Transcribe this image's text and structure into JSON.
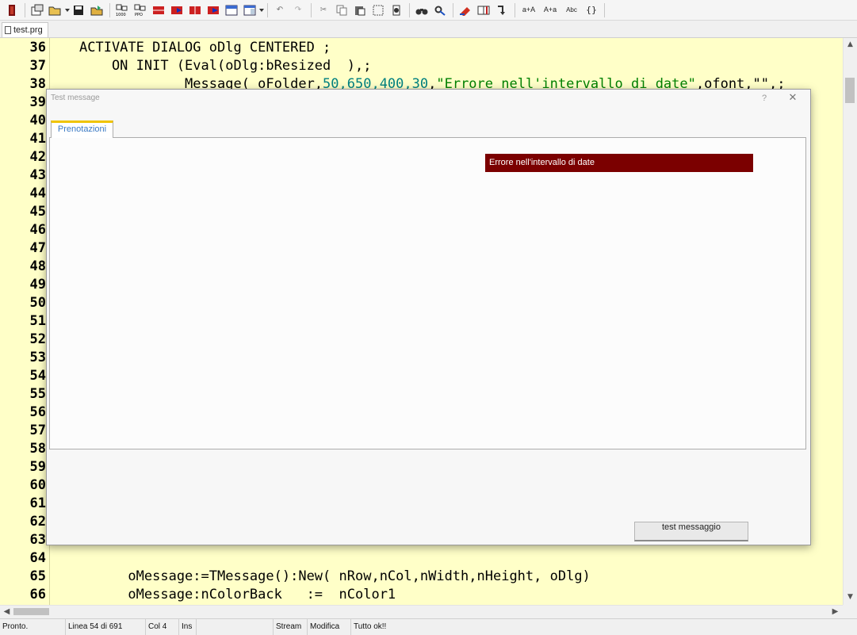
{
  "toolbar": {
    "icons": [
      "exit-icon",
      "new-project-icon",
      "open-folder-icon",
      "save-icon",
      "open-file-icon",
      "build-icon",
      "build-ppo-icon",
      "macro-icon-1",
      "macro-icon-2",
      "macro-icon-3",
      "macro-icon-4",
      "window-icon-1",
      "window-icon-2",
      "undo-icon",
      "redo-icon",
      "cut-icon",
      "copy-icon",
      "paste-icon",
      "select-all-icon",
      "replace-icon",
      "find-icon",
      "find-next-icon",
      "bookmark-icon",
      "book-icon",
      "goto-icon",
      "lowercase-icon",
      "uppercase-icon",
      "spell-check-icon",
      "braces-icon"
    ],
    "text_buttons": {
      "lowercase": "a+A",
      "uppercase": "A+a",
      "spell": "Abc",
      "braces": "{}"
    }
  },
  "tabs": {
    "file": "test.prg"
  },
  "editor": {
    "lines": [
      {
        "num": "36",
        "code": "ACTIVATE DIALOG oDlg CENTERED ;"
      },
      {
        "num": "37",
        "code": "    ON INIT (Eval(oDlg:bResized  ),;"
      },
      {
        "num": "38",
        "code_prefix": "             Message( oFolder,",
        "code_nums": "50,650,400,30",
        "code_mid": ",",
        "code_str": "\"Errore nell'intervallo di date\"",
        "code_suffix": ",ofont,\"\",;"
      },
      {
        "num": "39",
        "code": ""
      },
      {
        "num": "40",
        "code": ""
      },
      {
        "num": "41",
        "code": ""
      },
      {
        "num": "42",
        "code": ""
      },
      {
        "num": "43",
        "code": ""
      },
      {
        "num": "44",
        "code": ""
      },
      {
        "num": "45",
        "code": ""
      },
      {
        "num": "46",
        "code": ""
      },
      {
        "num": "47",
        "code": ""
      },
      {
        "num": "48",
        "code": ""
      },
      {
        "num": "49",
        "code": ""
      },
      {
        "num": "50",
        "code": ""
      },
      {
        "num": "51",
        "code": ""
      },
      {
        "num": "52",
        "code": ""
      },
      {
        "num": "53",
        "code": ""
      },
      {
        "num": "54",
        "code": ""
      },
      {
        "num": "55",
        "code": ""
      },
      {
        "num": "56",
        "code": ""
      },
      {
        "num": "57",
        "code": ""
      },
      {
        "num": "58",
        "code": ""
      },
      {
        "num": "59",
        "code": ""
      },
      {
        "num": "60",
        "code": ""
      },
      {
        "num": "61",
        "code": ""
      },
      {
        "num": "62",
        "code": ""
      },
      {
        "num": "63",
        "code": ""
      },
      {
        "num": "64",
        "code": ""
      },
      {
        "num": "65",
        "code": "      oMessage:=TMessage():New( nRow,nCol,nWidth,nHeight, oDlg)"
      },
      {
        "num": "66",
        "code": "      oMessage:nColorBack   :=  nColor1"
      }
    ]
  },
  "dialog": {
    "title": "Test message",
    "help": "?",
    "close": "✕",
    "folder_tab": "Prenotazioni",
    "message_text": "Errore nell'intervallo di date",
    "message_color": "#7b0000",
    "button_label": "test messaggio"
  },
  "statusbar": {
    "ready": "Pronto.",
    "line": "Linea 54 di  691",
    "col": "Col 4",
    "ins": "Ins",
    "stream": "Stream",
    "modify": "Modifica",
    "message": "Tutto ok!!"
  },
  "colors": {
    "editor_bg": "#ffffc8",
    "number": "#008080",
    "string": "#008000",
    "tab_accent": "#f0c400"
  }
}
